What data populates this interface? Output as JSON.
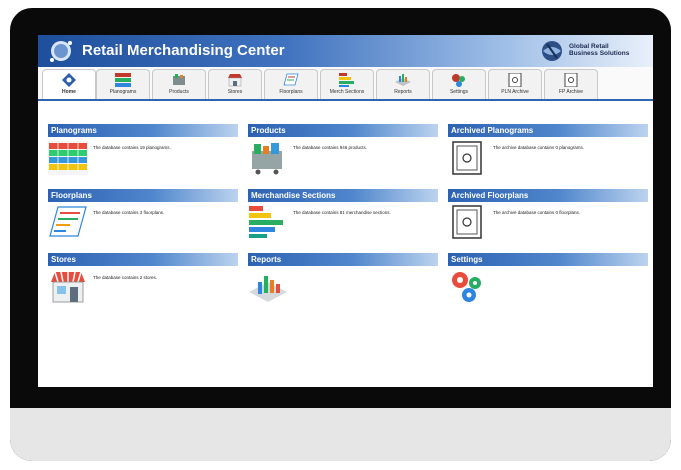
{
  "app": {
    "title": "Retail Merchandising Center",
    "brand_line1": "Global Retail",
    "brand_line2": "Business Solutions"
  },
  "tabs": [
    {
      "label": "Home",
      "icon": "home-icon",
      "active": true
    },
    {
      "label": "Planograms",
      "icon": "planogram-icon"
    },
    {
      "label": "Products",
      "icon": "products-icon"
    },
    {
      "label": "Stores",
      "icon": "store-icon"
    },
    {
      "label": "Floorplans",
      "icon": "floorplan-icon"
    },
    {
      "label": "Merch Sections",
      "icon": "merch-sections-icon"
    },
    {
      "label": "Reports",
      "icon": "reports-icon"
    },
    {
      "label": "Settings",
      "icon": "settings-gear-icon"
    },
    {
      "label": "PLN Archive",
      "icon": "archive-safe-icon"
    },
    {
      "label": "FP Archive",
      "icon": "archive-safe-icon"
    }
  ],
  "sections": {
    "planograms": {
      "title": "Planograms",
      "desc": "The database contains 19 planograms."
    },
    "products": {
      "title": "Products",
      "desc": "The database contains 946 products."
    },
    "archived_planograms": {
      "title": "Archived Planograms",
      "desc": "The archive database contains 0 planograms."
    },
    "floorplans": {
      "title": "Floorplans",
      "desc": "The database contains 3 floorplans."
    },
    "merchandise_sections": {
      "title": "Merchandise Sections",
      "desc": "The database contains 81 merchandise sections."
    },
    "archived_floorplans": {
      "title": "Archived Floorplans",
      "desc": "The archive database contains 0 floorplans."
    },
    "stores": {
      "title": "Stores",
      "desc": "The database contains 2 stores."
    },
    "reports": {
      "title": "Reports",
      "desc": ""
    },
    "settings": {
      "title": "Settings",
      "desc": ""
    }
  }
}
